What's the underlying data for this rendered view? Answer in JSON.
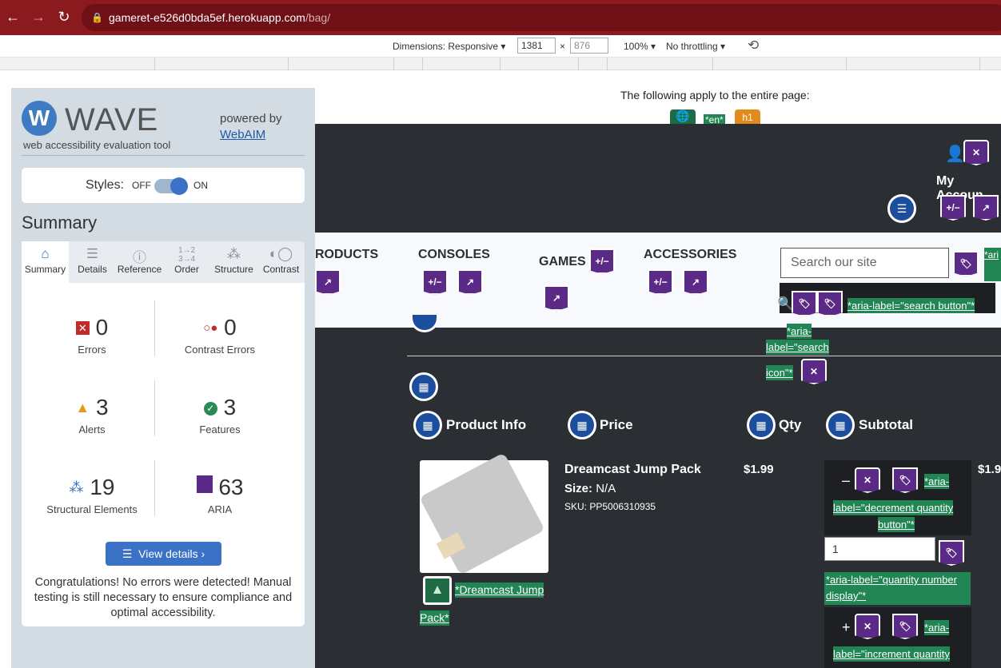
{
  "browser": {
    "url_host": "gameret-e526d0bda5ef.herokuapp.com",
    "url_path": "/bag/",
    "back_icon": "arrow-left-icon",
    "forward_icon": "arrow-right-icon",
    "reload_icon": "reload-icon"
  },
  "devtools": {
    "dimensions_label": "Dimensions: Responsive",
    "width_value": "1381",
    "times": "×",
    "height_value": "876",
    "zoom": "100%",
    "throttling": "No throttling"
  },
  "wave": {
    "logo_text": "WAVE",
    "tagline": "web accessibility evaluation tool",
    "powered_by": "powered by",
    "webaim": "WebAIM",
    "styles_label": "Styles:",
    "styles_off": "OFF",
    "styles_on": "ON",
    "summary_heading": "Summary",
    "tabs": [
      "Summary",
      "Details",
      "Reference",
      "Order",
      "Structure",
      "Contrast"
    ],
    "stats": {
      "errors": {
        "value": "0",
        "label": "Errors"
      },
      "contrast": {
        "value": "0",
        "label": "Contrast Errors"
      },
      "alerts": {
        "value": "3",
        "label": "Alerts"
      },
      "features": {
        "value": "3",
        "label": "Features"
      },
      "structural": {
        "value": "19",
        "label": "Structural Elements"
      },
      "aria": {
        "value": "63",
        "label": "ARIA"
      }
    },
    "view_details": "View details ›",
    "congrats": "Congratulations! No errors were detected! Manual testing is still necessary to ensure compliance and optimal accessibility."
  },
  "page": {
    "apply_text": "The following apply to the entire page:",
    "lang_label": "*en*",
    "h1_label": "h1",
    "my_account": "My Accoun",
    "nav": {
      "products": "RODUCTS",
      "consoles": "CONSOLES",
      "games": "GAMES",
      "accessories": "ACCESSORIES"
    },
    "search_placeholder": "Search our site",
    "aria_search_button": "*aria-label=\"search button\"*",
    "aria_search_icon_1": "*aria-",
    "aria_search_icon_2": "label=\"search",
    "aria_search_icon_3": "icon\"*",
    "aria_partial": "*ari",
    "table_headers": [
      "Product Info",
      "Price",
      "Qty",
      "Subtotal"
    ],
    "product": {
      "name": "Dreamcast Jump Pack",
      "size_label": "Size:",
      "size_value": "N/A",
      "sku": "SKU: PP5006310935",
      "price": "$1.99",
      "subtotal": "$1.9",
      "alt_text_1": "*Dreamcast Jump",
      "alt_text_2": "Pack*"
    },
    "qty": {
      "minus": "–",
      "plus": "+",
      "value": "1",
      "aria_dec_1": "*aria-",
      "aria_dec_2": "label=\"decrement quantity",
      "aria_dec_3": "button\"*",
      "aria_qty_1": "*aria-label=\"quantity number",
      "aria_qty_2": "display\"*",
      "aria_inc_1": "*aria-",
      "aria_inc_2": "label=\"increment quantity"
    }
  }
}
